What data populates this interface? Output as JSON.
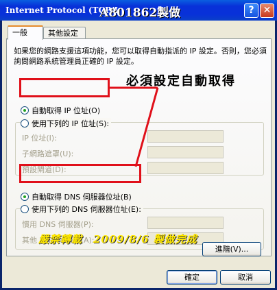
{
  "window": {
    "title": "Internet Protocol (TCP/I",
    "watermark": "A801862製做",
    "help_glyph": "?",
    "close_glyph": "✕"
  },
  "tabs": [
    {
      "label": "一般"
    },
    {
      "label": "其他設定"
    }
  ],
  "description": "如果您的網路支援這項功能，您可以取得自動指派的 IP 設定。否則，您必須詢問網路系統管理員正確的 IP 設定。",
  "ip": {
    "auto_label": "自動取得 IP 位址(O)",
    "manual_label": "使用下列的 IP 位址(S):",
    "fields": [
      {
        "label": "IP 位址(I):",
        "value": ""
      },
      {
        "label": "子網路遮罩(U):",
        "value": ""
      },
      {
        "label": "預設閘道(D):",
        "value": ""
      }
    ]
  },
  "dns": {
    "auto_label": "自動取得 DNS 伺服器位址(B)",
    "manual_label": "使用下列的 DNS 伺服器位址(E):",
    "fields": [
      {
        "label": "慣用 DNS 伺服器(P):",
        "value": ""
      },
      {
        "label": "其他 DNS 伺服器(A):",
        "value": ""
      }
    ]
  },
  "annotation": "必須設定自動取得",
  "caption": "嚴禁轉載　2009/8/6 製做完成",
  "buttons": {
    "advanced": "進階(V)...",
    "ok": "確定",
    "cancel": "取消"
  },
  "colors": {
    "highlight_box": "#e0101a",
    "caption_text": "#ffe800",
    "selected_radio": "#21a121"
  }
}
